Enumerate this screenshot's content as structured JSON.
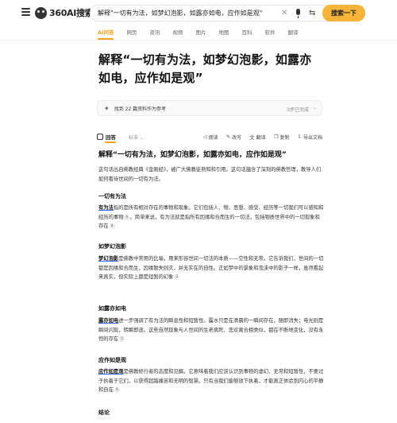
{
  "header": {
    "logo_text": "360AI搜索",
    "search_value": "解释\"一切有为法，如梦幻泡影，如露亦如电，应作如是观\"",
    "clear_glyph": "✕",
    "camera_glyph": "⇆",
    "search_button_label": "搜索一下"
  },
  "tabs": [
    {
      "label": "AI问答",
      "active": true
    },
    {
      "label": "网页"
    },
    {
      "label": "资讯"
    },
    {
      "label": "视频"
    },
    {
      "label": "图片"
    },
    {
      "label": "地图"
    },
    {
      "label": "百科"
    },
    {
      "label": "软件"
    },
    {
      "label": "翻译"
    }
  ],
  "main": {
    "title": "解释“一切有为法，如梦幻泡影，如露亦如电，应作如是观”",
    "references": {
      "icon_glyph": "✦",
      "text": "找到 22 篇资料作为参考",
      "status": "3步已完成",
      "chevron_glyph": "⌄"
    }
  },
  "toolbar": {
    "answer_label": "回答",
    "mode_label": "标准 ⌄",
    "tools": [
      {
        "icon": "◁",
        "label": "朗读"
      },
      {
        "icon": "✎",
        "label": "改写"
      },
      {
        "icon": "文",
        "label": "翻译"
      },
      {
        "icon": "❐",
        "label": "复制"
      },
      {
        "icon": "⇩",
        "label": "导出文档"
      }
    ]
  },
  "answer": {
    "title": "解释“一切有为法，如梦幻泡影，如露亦如电，应作如是观”",
    "intro": "这句话出自佛教经典《金刚经》，被广大佛教徒熟知和引用。这句话蕴含了深刻的佛教哲理，教导人们如何看待世间的一切有为法。",
    "sections": [
      {
        "heading": "一切有为法",
        "term": "有为法",
        "text": "指的是所有相对存在的事物和现象。它们包括人、物、思想、感受、经历等一切我们可以感知和经历的事物",
        "cite1": "6",
        "text2": "。简单来说，有为法就是指所有因缘和合而生的一切法，包括物质世界中的一切现象和存在",
        "cite2": "8"
      },
      {
        "heading": "如梦幻泡影",
        "term": "梦幻泡影",
        "text": "是佛教中常用的比喻，用来形容世间一切法的本质——空性和无常。它告诉我们，世间的一切都是因缘和合而生，因缘散失则灭，并无实在的自性。正如梦中的景象和泡沫中的影子一样，虽然看起来真实，但实际上都是短暂的幻象",
        "cite1": "2"
      },
      {
        "heading": "如露亦如电",
        "term": "露亦如电",
        "text": "进一步强调了有为法的瞬息性和短暂性。露水只是在清晨的一瞬间存在，随即消失；电光则是瞬间闪现，转瞬即逝。这些自然现象与人世间的生老病死、悲欢离合相类似，都在不断地变化，没有永恒的存在",
        "cite1": "5"
      },
      {
        "heading": "应作如是观",
        "term": "应作如是观",
        "text": "是佛教修行者的态度和见解。它意味着我们应该认识到事物的虚幻、无常和短暂性，不要过于执着于它们，以获得超越痛苦和无明的智慧。只有当我们能够放下执着，才能真正体验到内心的平静和自在",
        "cite1": "6"
      }
    ],
    "conclusion_heading": "结论"
  }
}
